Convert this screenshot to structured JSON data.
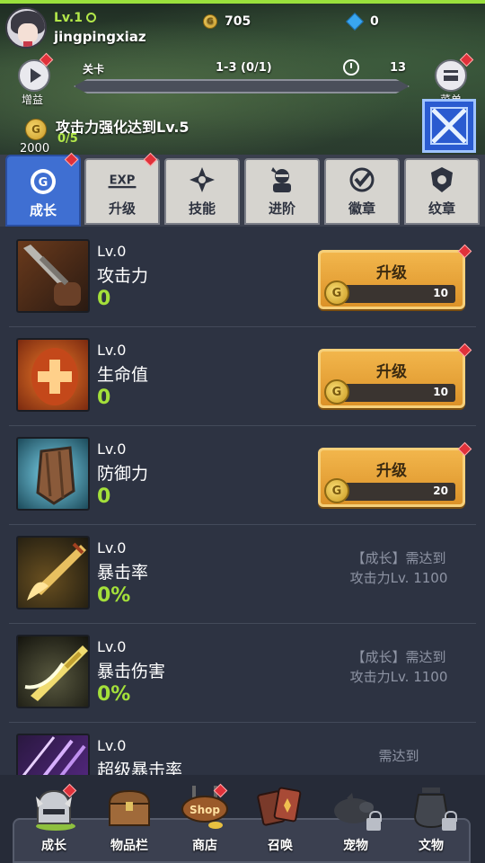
{
  "player": {
    "level": "Lv.1",
    "name": "jingpingxiaz"
  },
  "currency": {
    "gold": "705",
    "gems": "0"
  },
  "side_buttons": {
    "left_label": "增益",
    "right_label": "菜单"
  },
  "stage": {
    "label": "关卡",
    "progress": "1-3 (0/1)",
    "timer": "13"
  },
  "quest": {
    "text": "攻击力强化达到Lv.5",
    "progress": "0/5",
    "reward": "2000"
  },
  "tabs": [
    {
      "label": "成长",
      "icon": "growth-coin-icon",
      "active": true
    },
    {
      "label": "升级",
      "icon": "exp-icon"
    },
    {
      "label": "技能",
      "icon": "skill-shuriken-icon"
    },
    {
      "label": "进阶",
      "icon": "advance-ninja-icon"
    },
    {
      "label": "徽章",
      "icon": "badge-icon"
    },
    {
      "label": "纹章",
      "icon": "crest-icon"
    }
  ],
  "stats": [
    {
      "level": "Lv.0",
      "name": "攻击力",
      "value": "0",
      "button": "升级",
      "cost": "10"
    },
    {
      "level": "Lv.0",
      "name": "生命值",
      "value": "0",
      "button": "升级",
      "cost": "10"
    },
    {
      "level": "Lv.0",
      "name": "防御力",
      "value": "0",
      "button": "升级",
      "cost": "20"
    },
    {
      "level": "Lv.0",
      "name": "暴击率",
      "value": "0%",
      "req_line1": "【成长】需达到",
      "req_line2": "攻击力Lv. 1100"
    },
    {
      "level": "Lv.0",
      "name": "暴击伤害",
      "value": "0%",
      "req_line1": "【成长】需达到",
      "req_line2": "攻击力Lv. 1100"
    },
    {
      "level": "Lv.0",
      "name": "超级暴击率",
      "req_line1": "需达到"
    }
  ],
  "nav": [
    {
      "label": "成长",
      "icon": "helmet-icon"
    },
    {
      "label": "物品栏",
      "icon": "chest-icon"
    },
    {
      "label": "商店",
      "icon": "shop-sign-icon",
      "sign_text": "Shop"
    },
    {
      "label": "召唤",
      "icon": "cards-icon"
    },
    {
      "label": "宠物",
      "icon": "pet-pig-icon"
    },
    {
      "label": "文物",
      "icon": "relic-urn-icon"
    }
  ],
  "colors": {
    "accent_green": "#a4e03a",
    "tab_active": "#3f6fd2",
    "button_orange": "#e9a63a",
    "reddot": "#e0313a"
  }
}
